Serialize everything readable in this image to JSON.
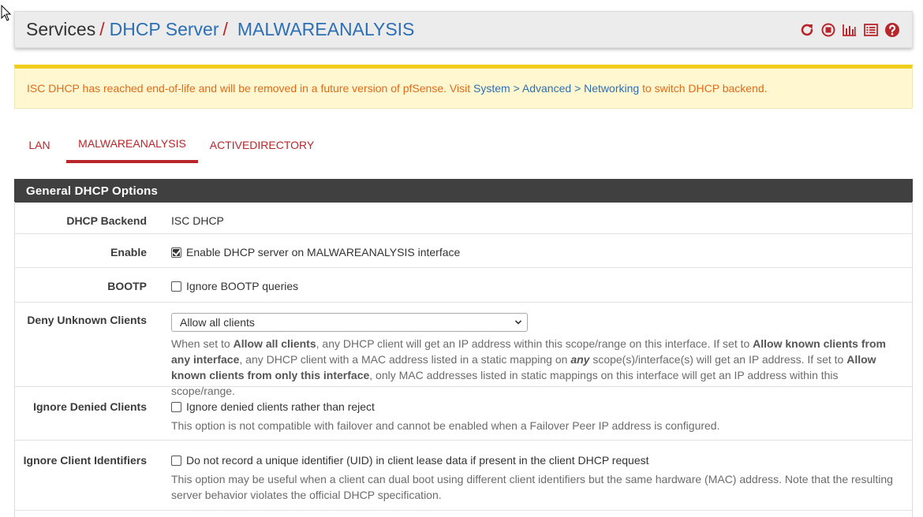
{
  "breadcrumb": {
    "root": "Services",
    "section": "DHCP Server",
    "current": "MALWAREANALYSIS",
    "separator": "/"
  },
  "alert": {
    "text_before": "ISC DHCP has reached end-of-life and will be removed in a future version of pfSense. Visit",
    "link_system": "System",
    "gt1": ">",
    "link_advanced": "Advanced",
    "gt2": ">",
    "link_networking": "Networking",
    "text_after": "to switch DHCP backend."
  },
  "tabs": [
    "LAN",
    "MALWAREANALYSIS",
    "ACTIVEDIRECTORY"
  ],
  "active_tab": "MALWAREANALYSIS",
  "panel": {
    "title": "General DHCP Options",
    "backend": {
      "label": "DHCP Backend",
      "value": "ISC DHCP"
    },
    "enable": {
      "label": "Enable",
      "checkbox_label": "Enable DHCP server on MALWAREANALYSIS interface",
      "checked": true
    },
    "bootp": {
      "label": "BOOTP",
      "checkbox_label": "Ignore BOOTP queries",
      "checked": false
    },
    "deny_unknown": {
      "label": "Deny Unknown Clients",
      "selected": "Allow all clients",
      "help": {
        "p1": "When set to",
        "b1": "Allow all clients",
        "p2": ", any DHCP client will get an IP address within this scope/range on this interface. If set to",
        "b2": "Allow known clients from any interface",
        "p3": ", any DHCP client with a MAC address listed in a static mapping on",
        "b3": "any",
        "p4": "scope(s)/interface(s) will get an IP address. If set to",
        "b4": "Allow known clients from only this interface",
        "p5": ", only MAC addresses listed in static mappings on this interface will get an IP address within this scope/range."
      }
    },
    "ignore_denied": {
      "label": "Ignore Denied Clients",
      "checkbox_label": "Ignore denied clients rather than reject",
      "checked": false,
      "help": "This option is not compatible with failover and cannot be enabled when a Failover Peer IP address is configured."
    },
    "ignore_client_ids": {
      "label": "Ignore Client Identifiers",
      "checkbox_label": "Do not record a unique identifier (UID) in client lease data if present in the client DHCP request",
      "checked": false,
      "help": "This option may be useful when a client can dual boot using different client identifiers but the same hardware (MAC) address. Note that the resulting server behavior violates the official DHCP specification."
    }
  },
  "icons": [
    "restart-icon",
    "stop-icon",
    "status-graph-icon",
    "log-icon",
    "help-icon"
  ],
  "colors": {
    "accent": "#b8262b",
    "link": "#2c6fb5",
    "alert_text": "#e06b1b",
    "alert_bg": "#fef7cf",
    "panel_head": "#404040"
  }
}
